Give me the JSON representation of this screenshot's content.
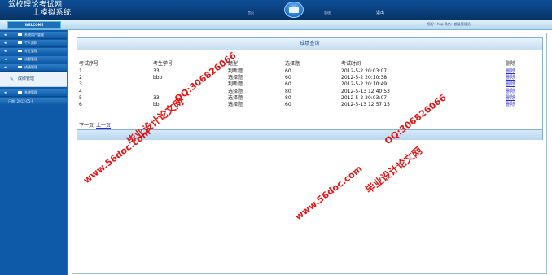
{
  "header": {
    "title_line1": "驾校理论考试网",
    "title_line2": "上模拟系统",
    "nav_left": "首页",
    "nav_right": "管理",
    "mail_icon": "mail-icon",
    "exit_label": "退出"
  },
  "topbar": {
    "welcome": "WELCOME",
    "user_info": "您好：hnp 角色：超级管理员"
  },
  "sidebar": {
    "items": [
      {
        "label": "系统用户管理"
      },
      {
        "label": "个人资料"
      },
      {
        "label": "考生管理"
      },
      {
        "label": "试题管理"
      },
      {
        "label": "成绩管理"
      }
    ],
    "active_sub": "成绩管理",
    "after_item": "系统管理",
    "date": "日期: 2012-05-9"
  },
  "main": {
    "panel_title": "成绩查询",
    "table": {
      "headers": [
        "考试序号",
        "考生学号",
        "题型",
        "选择题",
        "考试时间",
        "删除"
      ],
      "rows": [
        [
          "1",
          "33",
          "判断题",
          "60",
          "2012-5-2 20:03:07",
          "删除"
        ],
        [
          "2",
          "bbb",
          "选择题",
          "60",
          "2012-5-2 20:10:38",
          "删除"
        ],
        [
          "3",
          "",
          "判断题",
          "60",
          "2012-5-2 20:10:49",
          "删除"
        ],
        [
          "4",
          "",
          "选择题",
          "80",
          "2012-5-13 12:40:53",
          "删除"
        ],
        [
          "5",
          "33",
          "选择题",
          "80",
          "2012-5-2 20:03:07",
          "删除"
        ],
        [
          "6",
          "bb",
          "选择题",
          "60",
          "2012-5-13 12:57:15",
          "删除"
        ]
      ]
    },
    "pager": {
      "first": "下一页",
      "prev": "上一页"
    }
  },
  "watermarks": {
    "site": "www.56doc.com",
    "qq": "QQ:306826066",
    "text": "毕业设计论文网"
  },
  "colors": {
    "header_bg": "#0a3f7c",
    "sidebar_bg": "#0e5aa8",
    "watermark": "#e00000",
    "link": "#2a2ad0"
  }
}
